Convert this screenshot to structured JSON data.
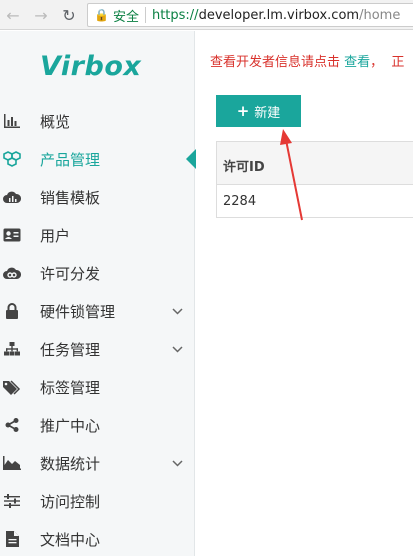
{
  "browser": {
    "back_icon": "arrow-left",
    "forward_icon": "arrow-right",
    "reload_icon": "reload",
    "secure_label": "安全",
    "url_protocol": "https://",
    "url_host": "developer.lm.virbox.com",
    "url_path": "/home"
  },
  "sidebar": {
    "logo": "Virbox",
    "items": [
      {
        "label": "概览",
        "icon": "bar-chart"
      },
      {
        "label": "产品管理",
        "icon": "cubes"
      },
      {
        "label": "销售模板",
        "icon": "cloud-chart"
      },
      {
        "label": "用户",
        "icon": "id-card"
      },
      {
        "label": "许可分发",
        "icon": "cloud-link"
      },
      {
        "label": "硬件锁管理",
        "icon": "lock",
        "expandable": true
      },
      {
        "label": "任务管理",
        "icon": "sitemap",
        "expandable": true
      },
      {
        "label": "标签管理",
        "icon": "tags"
      },
      {
        "label": "推广中心",
        "icon": "share"
      },
      {
        "label": "数据统计",
        "icon": "area-chart",
        "expandable": true
      },
      {
        "label": "访问控制",
        "icon": "sliders"
      },
      {
        "label": "文档中心",
        "icon": "document"
      }
    ],
    "active_index": 1
  },
  "main": {
    "notice_text": "查看开发者信息请点击",
    "notice_link": "查看",
    "notice_tail": "，",
    "notice_tail2": "正",
    "new_button_label": "新建",
    "table": {
      "columns": [
        "许可ID"
      ],
      "rows": [
        [
          "2284"
        ]
      ]
    }
  },
  "colors": {
    "accent": "#1aa69c",
    "notice": "#d9322c",
    "annotation_arrow": "#e53935"
  }
}
